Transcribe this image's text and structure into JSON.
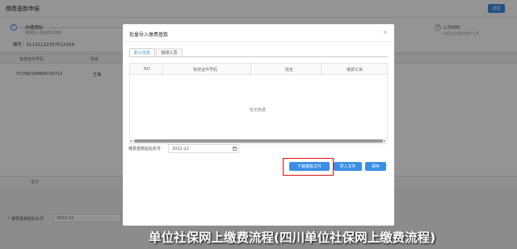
{
  "background": {
    "title": "缴费基数申报",
    "back_label": "返回",
    "step1": {
      "check": "✓",
      "title": "办理须知",
      "desc1": "请根据入面再提交审核",
      "desc2": ""
    },
    "code_label": "编号：S1131122337512204",
    "step4": {
      "num": "4",
      "title": "上传材料",
      "desc": "扫描业务相关材料上传"
    },
    "table": {
      "headers": [
        "有效证件号码",
        "姓名"
      ],
      "row": [
        "371082199604130712",
        "王海"
      ],
      "total_label": "合计"
    },
    "form": {
      "label": "* 缴费基数起始年月",
      "value": "2021-12"
    }
  },
  "modal": {
    "title": "批量导入缴费基数",
    "close": "×",
    "tabs": [
      {
        "label": "职工信息",
        "active": true
      },
      {
        "label": "错误人员",
        "active": false
      }
    ],
    "table_headers": [
      "NO",
      "有效证件号码",
      "姓名",
      "缴费工资"
    ],
    "empty_text": "暂无数据",
    "scroll_left": "◂",
    "scroll_right": "▸",
    "form": {
      "label": "缴费基数起始年月",
      "value": "2021-12"
    },
    "buttons": {
      "download": "下载模板文件",
      "import": "导入文件",
      "save": "保存"
    }
  },
  "caption": "单位社保网上缴费流程(四川单位社保网上缴费流程)",
  "colors": {
    "primary": "#3a8ee6",
    "highlight": "#dd1111",
    "overlay": "rgba(0,0,0,0.42)"
  }
}
